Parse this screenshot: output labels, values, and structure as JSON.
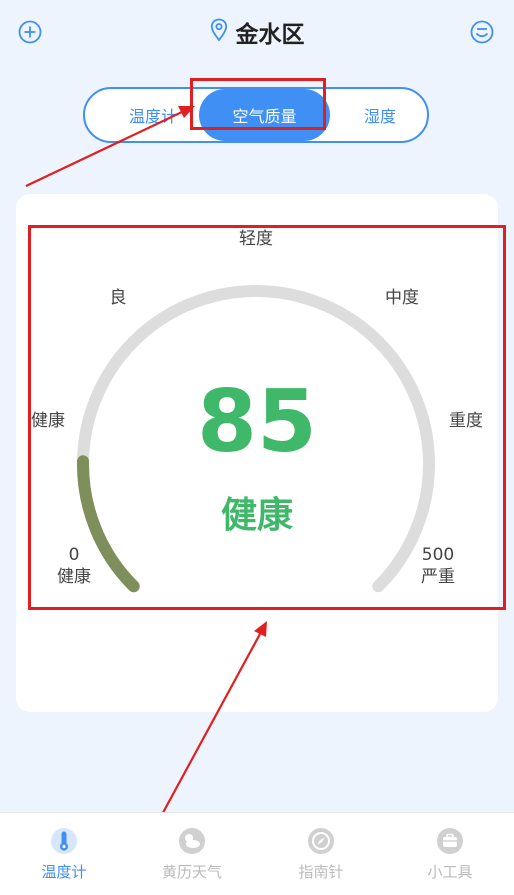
{
  "header": {
    "location": "金水区",
    "add_icon": "plus-circle-icon",
    "location_icon": "map-pin-icon",
    "profile_icon": "smiley-face-icon"
  },
  "tabs": [
    {
      "label": "温度计",
      "active": false
    },
    {
      "label": "空气质量",
      "active": true
    },
    {
      "label": "湿度",
      "active": false
    }
  ],
  "gauge": {
    "value": "85",
    "status": "健康",
    "min_value": "0",
    "min_label": "健康",
    "max_value": "500",
    "max_label": "严重",
    "level_labels": [
      "健康",
      "良",
      "轻度",
      "中度",
      "重度"
    ],
    "fill_fraction": 0.17,
    "colors": {
      "track": "#dddddd",
      "fill_start": "#7e8f5c",
      "fill_end": "#6e9a66",
      "value": "#3fb86a"
    }
  },
  "bottom_nav": [
    {
      "label": "温度计",
      "icon": "thermometer-icon",
      "active": true
    },
    {
      "label": "黄历天气",
      "icon": "weather-icon",
      "active": false
    },
    {
      "label": "指南针",
      "icon": "compass-icon",
      "active": false
    },
    {
      "label": "小工具",
      "icon": "toolbox-icon",
      "active": false
    }
  ],
  "colors": {
    "accent": "#3f8ff5",
    "highlight": "#e02020",
    "background": "#edf4fd"
  }
}
